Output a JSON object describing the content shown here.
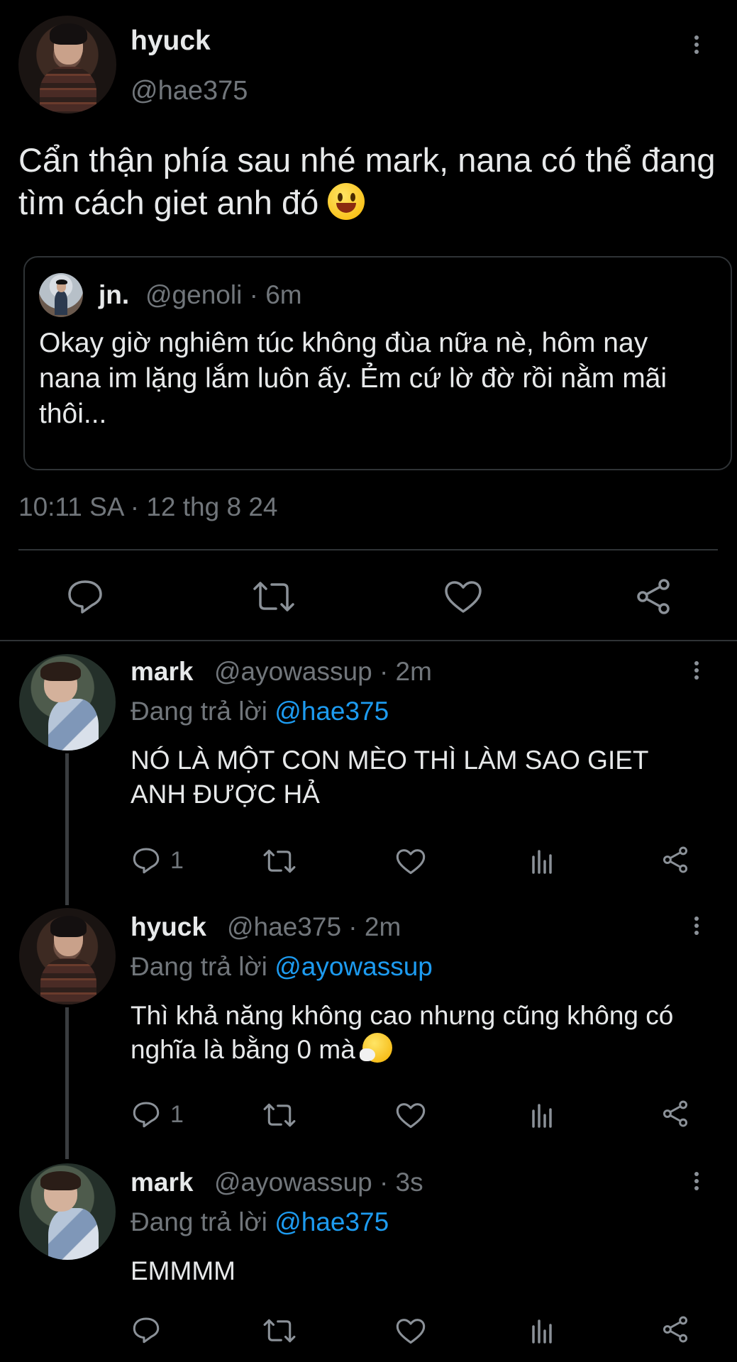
{
  "main_tweet": {
    "display_name": "hyuck",
    "handle": "@hae375",
    "text": "Cẩn thận phía sau nhé mark, nana có thể đang tìm cách giet anh đó",
    "emoji": "grinning-face-emoji",
    "quote": {
      "display_name": "jn.",
      "handle_time": "@genoli · 6m",
      "text": "Okay giờ nghiêm túc không đùa nữa nè, hôm nay nana im lặng lắm luôn ấy. Ẻm cứ lờ đờ rồi nằm mãi thôi..."
    },
    "timestamp": "10:11 SA · 12 thg 8 24",
    "actions": [
      "reply-icon",
      "retweet-icon",
      "like-icon",
      "share-icon"
    ]
  },
  "replies": [
    {
      "display_name": "mark",
      "handle_time": "@ayowassup · 2m",
      "replying_prefix": "Đang trả lời",
      "replying_to": "@hae375",
      "text": "NÓ LÀ MỘT CON MÈO THÌ LÀM SAO GIET ANH ĐƯỢC HẢ",
      "reply_count": "1"
    },
    {
      "display_name": "hyuck",
      "handle_time": "@hae375 · 2m",
      "replying_prefix": "Đang trả lời",
      "replying_to": "@ayowassup",
      "text": "Thì khả năng không cao nhưng cũng không có nghĩa là bằng 0 mà",
      "emoji": "sneezing-face-emoji",
      "reply_count": "1"
    },
    {
      "display_name": "mark",
      "handle_time": "@ayowassup · 3s",
      "replying_prefix": "Đang trả lời",
      "replying_to": "@hae375",
      "text": "EMMMM",
      "reply_count": ""
    }
  ],
  "colors": {
    "background": "#000000",
    "text": "#e7e9ea",
    "secondary": "#71767b",
    "link": "#1d9bf0",
    "border": "#2f3336"
  }
}
